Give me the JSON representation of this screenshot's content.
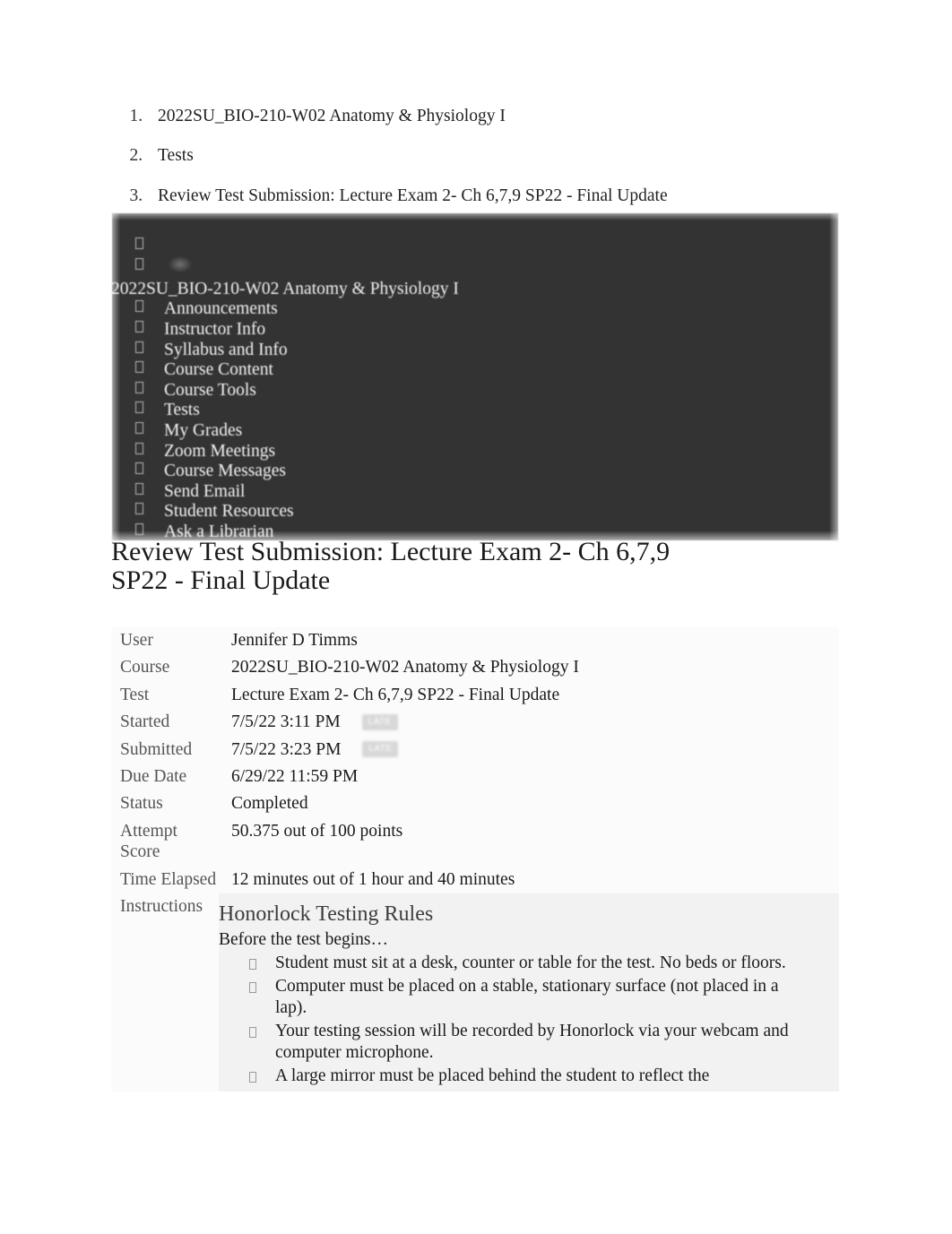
{
  "breadcrumb": {
    "items": [
      "2022SU_BIO-210-W02 Anatomy & Physiology I",
      "Tests",
      "Review Test Submission: Lecture Exam 2- Ch 6,7,9 SP22 - Final Update"
    ]
  },
  "course_menu": {
    "course_title": "2022SU_BIO-210-W02 Anatomy & Physiology I",
    "background_color": "#333333",
    "text_color": "#f4f4f4",
    "items": [
      "Announcements",
      "Instructor Info",
      "Syllabus and Info",
      "Course Content",
      "Course Tools",
      "Tests",
      "My Grades",
      "Zoom Meetings",
      "Course Messages",
      "Send Email",
      "Student Resources",
      "Ask a Librarian"
    ]
  },
  "page": {
    "title": "Review Test Submission: Lecture Exam 2- Ch 6,7,9 SP22 - Final Update"
  },
  "attempt": {
    "rows": [
      {
        "label": "User",
        "value": "Jennifer D Timms",
        "badge": ""
      },
      {
        "label": "Course",
        "value": "2022SU_BIO-210-W02 Anatomy & Physiology I",
        "badge": ""
      },
      {
        "label": "Test",
        "value": "Lecture Exam 2- Ch 6,7,9 SP22 - Final Update",
        "badge": ""
      },
      {
        "label": "Started",
        "value": "7/5/22 3:11 PM",
        "badge": "LATE"
      },
      {
        "label": "Submitted",
        "value": "7/5/22 3:23 PM",
        "badge": "LATE"
      },
      {
        "label": "Due Date",
        "value": "6/29/22 11:59 PM",
        "badge": ""
      },
      {
        "label": "Status",
        "value": "Completed",
        "badge": ""
      },
      {
        "label": "Attempt Score",
        "value": "50.375 out of 100 points",
        "badge": ""
      },
      {
        "label": "Time Elapsed",
        "value": "12 minutes out of 1 hour and 40 minutes",
        "badge": ""
      }
    ],
    "instructions_label": "Instructions"
  },
  "instructions": {
    "heading": "Honorlock Testing Rules",
    "subheading": "Before the test begins…",
    "bullets": [
      "Student must sit at a desk, counter or table for the test. No beds or floors.",
      "Computer must be placed on a stable, stationary surface (not placed in a lap).",
      "Your testing session will be recorded by Honorlock via your webcam and computer microphone.",
      "A large mirror must be placed behind the student to reflect the"
    ]
  }
}
